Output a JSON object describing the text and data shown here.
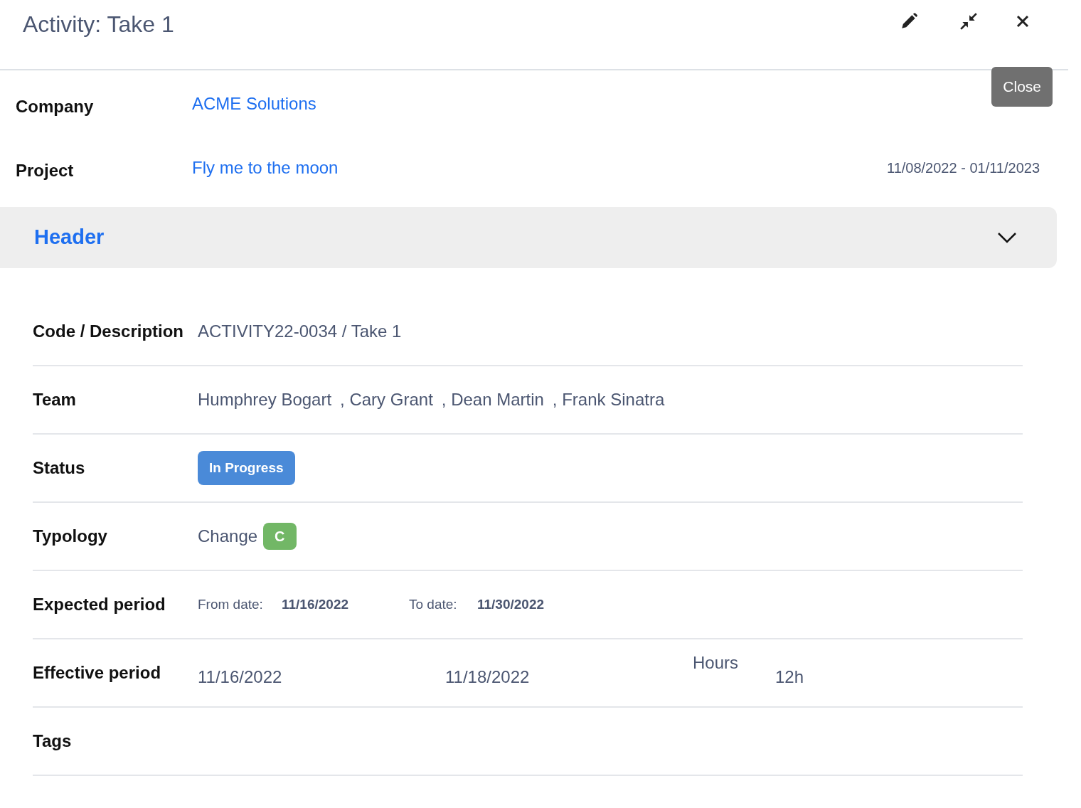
{
  "window": {
    "title": "Activity: Take 1"
  },
  "close_button": "Close",
  "summary": [
    {
      "label": "Company",
      "link": "ACME Solutions"
    },
    {
      "label": "Project",
      "link": "Fly me to the moon",
      "period": "11/08/2022 - 01/11/2023"
    }
  ],
  "section": {
    "title": "Header",
    "expanded": true
  },
  "fields": [
    {
      "kind": "text",
      "label": "Code / Description",
      "value": "ACTIVITY22-0034 / Take 1"
    },
    {
      "kind": "team",
      "label": "Team",
      "members": [
        "Humphrey Bogart",
        ", Cary Grant",
        ", Dean Martin",
        ", Frank Sinatra"
      ]
    },
    {
      "kind": "status",
      "label": "Status",
      "value": "In Progress",
      "color": "#4a8ad8"
    },
    {
      "kind": "typology",
      "label": "Typology",
      "value": "Change",
      "badge": "C",
      "color": "#72b766"
    },
    {
      "kind": "expected",
      "label": "Expected period",
      "from_label": "From date:",
      "from": "11/16/2022",
      "to_label": "To date:",
      "to": "11/30/2022"
    },
    {
      "kind": "effective",
      "label": "Effective period",
      "from": "11/16/2022",
      "to": "11/18/2022",
      "hours_label": "Hours",
      "hours": "12h"
    },
    {
      "kind": "tags",
      "label": "Tags"
    }
  ]
}
